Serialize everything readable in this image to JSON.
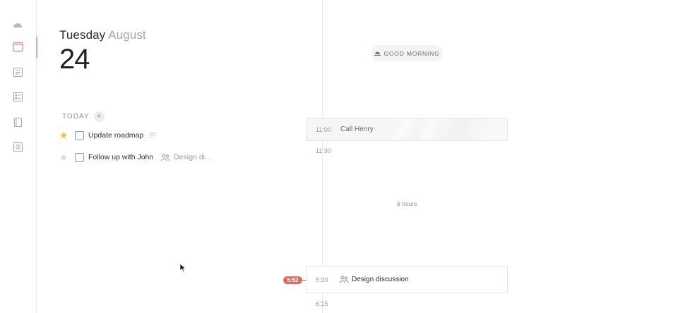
{
  "sidebar": {
    "items": [
      {
        "icon": "weather-icon"
      },
      {
        "icon": "calendar-day-icon",
        "active": true
      },
      {
        "icon": "notes-icon"
      },
      {
        "icon": "checklist-icon"
      },
      {
        "icon": "notebook-icon"
      },
      {
        "icon": "document-icon"
      }
    ],
    "accent": "#d36f66"
  },
  "date": {
    "weekday": "Tuesday",
    "month": "August",
    "day": "24"
  },
  "today": {
    "label": "TODAY",
    "add_label": "+",
    "tasks": [
      {
        "title": "Update roadmap",
        "starred": true,
        "done": false,
        "has_note": true
      },
      {
        "title": "Follow up with John",
        "starred": false,
        "done": false,
        "linked_event": "Design di..."
      }
    ]
  },
  "greeting": {
    "icon": "sunrise-icon",
    "text": "GOOD MORNING"
  },
  "timeline": {
    "events": [
      {
        "time": "11:00",
        "title": "Call Henry"
      },
      {
        "time": "5:30",
        "title": "Design discussion",
        "icon": "people-icon"
      }
    ],
    "marks": {
      "after_first": "11:30",
      "after_second": "6:15"
    },
    "gap_label": "6 hours",
    "now": "5:52",
    "now_color": "#d36f66"
  }
}
